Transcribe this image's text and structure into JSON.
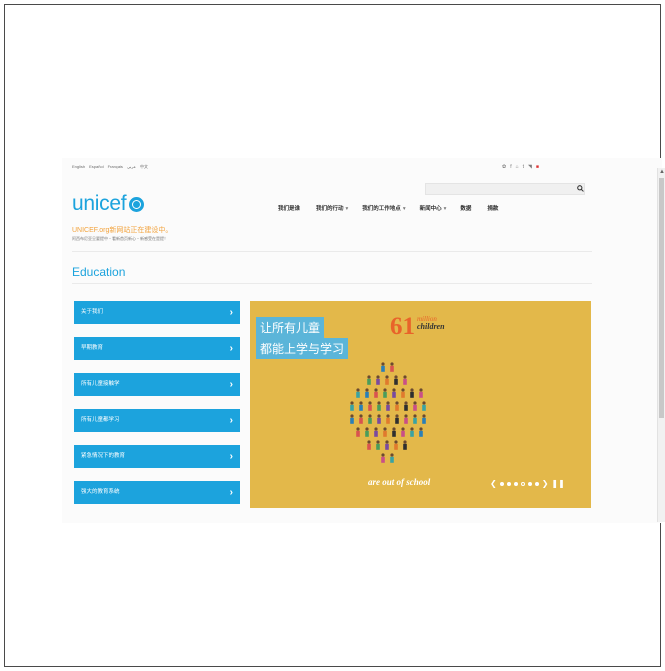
{
  "top_bar": {
    "languages": [
      "English",
      "Español",
      "Français",
      "عربي",
      "中文"
    ],
    "social_icons": [
      "weibo-icon",
      "facebook-icon",
      "renren-icon",
      "tumblr-icon",
      "rss-icon",
      "flag-icon"
    ]
  },
  "logo": {
    "text": "unicef"
  },
  "search": {
    "placeholder": ""
  },
  "nav": [
    {
      "label": "我们是谁",
      "caret": ""
    },
    {
      "label": "我们的行动",
      "caret": "▾"
    },
    {
      "label": "我们的工作地点",
      "caret": "▾"
    },
    {
      "label": "新闻中心",
      "caret": "▾"
    },
    {
      "label": "数据",
      "caret": ""
    },
    {
      "label": "捐款",
      "caret": ""
    }
  ],
  "notice": {
    "title": "UNICEF.org新网站正在建设中。",
    "subtitle": "阿西布尼亚旦要提中・看新首页新心・新感受在是提！"
  },
  "section_title": "Education",
  "menu": [
    {
      "label": "关于我们"
    },
    {
      "label": "早期教育"
    },
    {
      "label": "所有儿童接触学"
    },
    {
      "label": "所有儿童都学习"
    },
    {
      "label": "紧急情况下的教育"
    },
    {
      "label": "强大的教育系统"
    }
  ],
  "banner": {
    "line1": "让所有儿童",
    "line2": "都能上学与学习",
    "stat_number": "61",
    "stat_unit": "million",
    "stat_label": "children",
    "caption": "are out of school",
    "carousel": {
      "prev": "❮",
      "next": "❯",
      "pause": "❚❚",
      "dots": 6,
      "active_index": 3
    }
  },
  "colors": {
    "brand_blue": "#1ca3dd",
    "banner_yellow": "#e3b84a",
    "accent_orange": "#e8632a",
    "notice_orange": "#f2a23b"
  }
}
